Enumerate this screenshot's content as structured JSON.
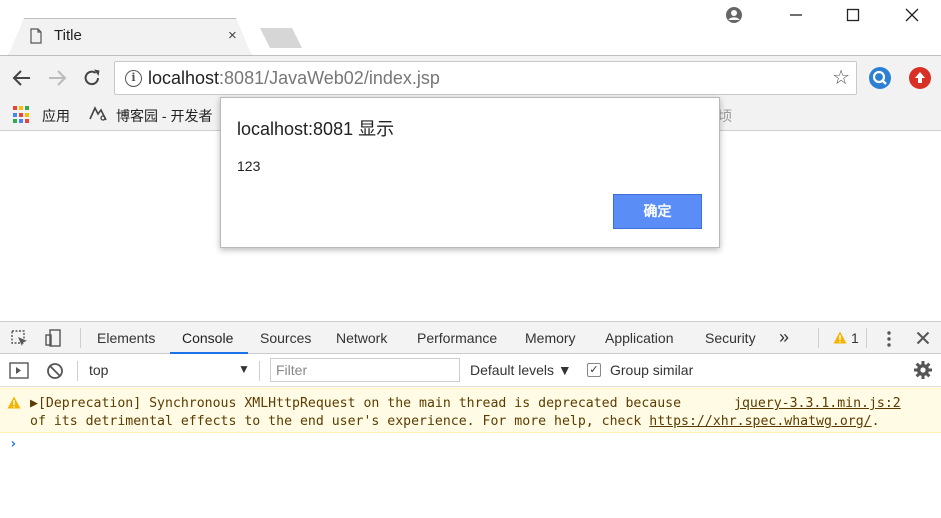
{
  "browser": {
    "tab": {
      "title": "Title",
      "close": "×"
    },
    "address": {
      "host": "localhost",
      "rest": ":8081/JavaWeb02/index.jsp"
    },
    "bookmarks": {
      "apps": "应用",
      "cnblogs": "博客园 - 开发者",
      "faded": "顷"
    }
  },
  "dialog": {
    "title": "localhost:8081 显示",
    "message": "123",
    "ok": "确定"
  },
  "devtools": {
    "tabs": [
      "Elements",
      "Console",
      "Sources",
      "Network",
      "Performance",
      "Memory",
      "Application",
      "Security"
    ],
    "active_tab": "Console",
    "more": "»",
    "warning_count": "1",
    "context": "top",
    "filter_placeholder": "Filter",
    "levels": "Default levels ▼",
    "group_similar": "Group similar",
    "console": {
      "warn_line1": "▶[Deprecation] Synchronous XMLHttpRequest on the main thread is deprecated because",
      "source": "jquery-3.3.1.min.js:2",
      "warn_line2_prefix": "of its detrimental effects to the end user's experience. For more help, check ",
      "link": "https://xhr.spec.whatwg.org/",
      "suffix": ".",
      "prompt": "›"
    }
  },
  "colors": {
    "accent": "#1a73e8",
    "ok_button": "#5a8ef6",
    "warning_bg": "#fffbe5",
    "warning_icon": "#f5b400"
  }
}
